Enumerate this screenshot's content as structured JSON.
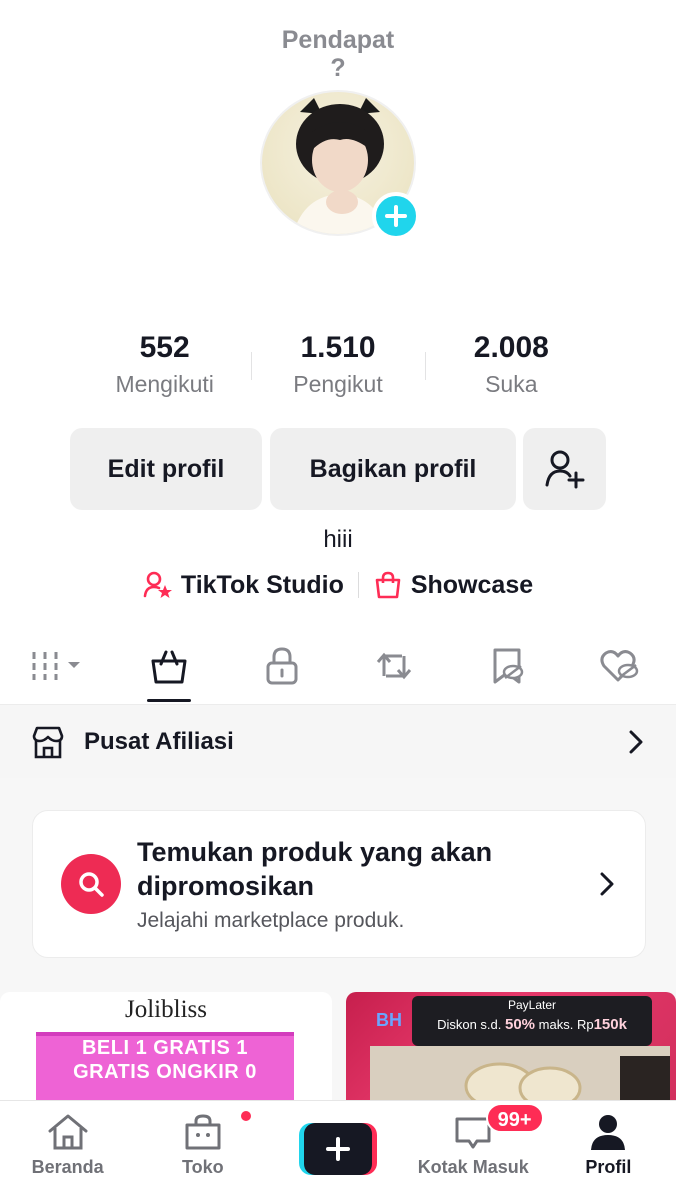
{
  "profile": {
    "title_line1": "Pendapat",
    "title_line2": "?",
    "bio": "hiii"
  },
  "stats": [
    {
      "value": "552",
      "label": "Mengikuti"
    },
    {
      "value": "1.510",
      "label": "Pengikut"
    },
    {
      "value": "2.008",
      "label": "Suka"
    }
  ],
  "buttons": {
    "edit": "Edit profil",
    "share": "Bagikan profil"
  },
  "links": {
    "studio": "TikTok Studio",
    "showcase": "Showcase"
  },
  "affiliate": {
    "title": "Pusat Afiliasi"
  },
  "promo": {
    "title": "Temukan produk yang akan dipromosikan",
    "subtitle": "Jelajahi marketplace produk."
  },
  "products": {
    "p1_brand": "Jolibliss",
    "p1_banner_line1": "BELI 1 GRATIS 1",
    "p1_banner_line2": "GRATIS ONGKIR 0",
    "p2_paylater": "PayLater",
    "p2_disc_prefix": "Diskon s.d.",
    "p2_disc_pct": "50%",
    "p2_disc_mid": "maks. Rp",
    "p2_disc_max": "150k",
    "p2_bh": "BH"
  },
  "nav": {
    "home": "Beranda",
    "shop": "Toko",
    "inbox": "Kotak Masuk",
    "inbox_badge": "99+",
    "profile": "Profil"
  },
  "colors": {
    "accent_red": "#fe2c55",
    "accent_cyan": "#20d5ec",
    "text": "#161823"
  }
}
